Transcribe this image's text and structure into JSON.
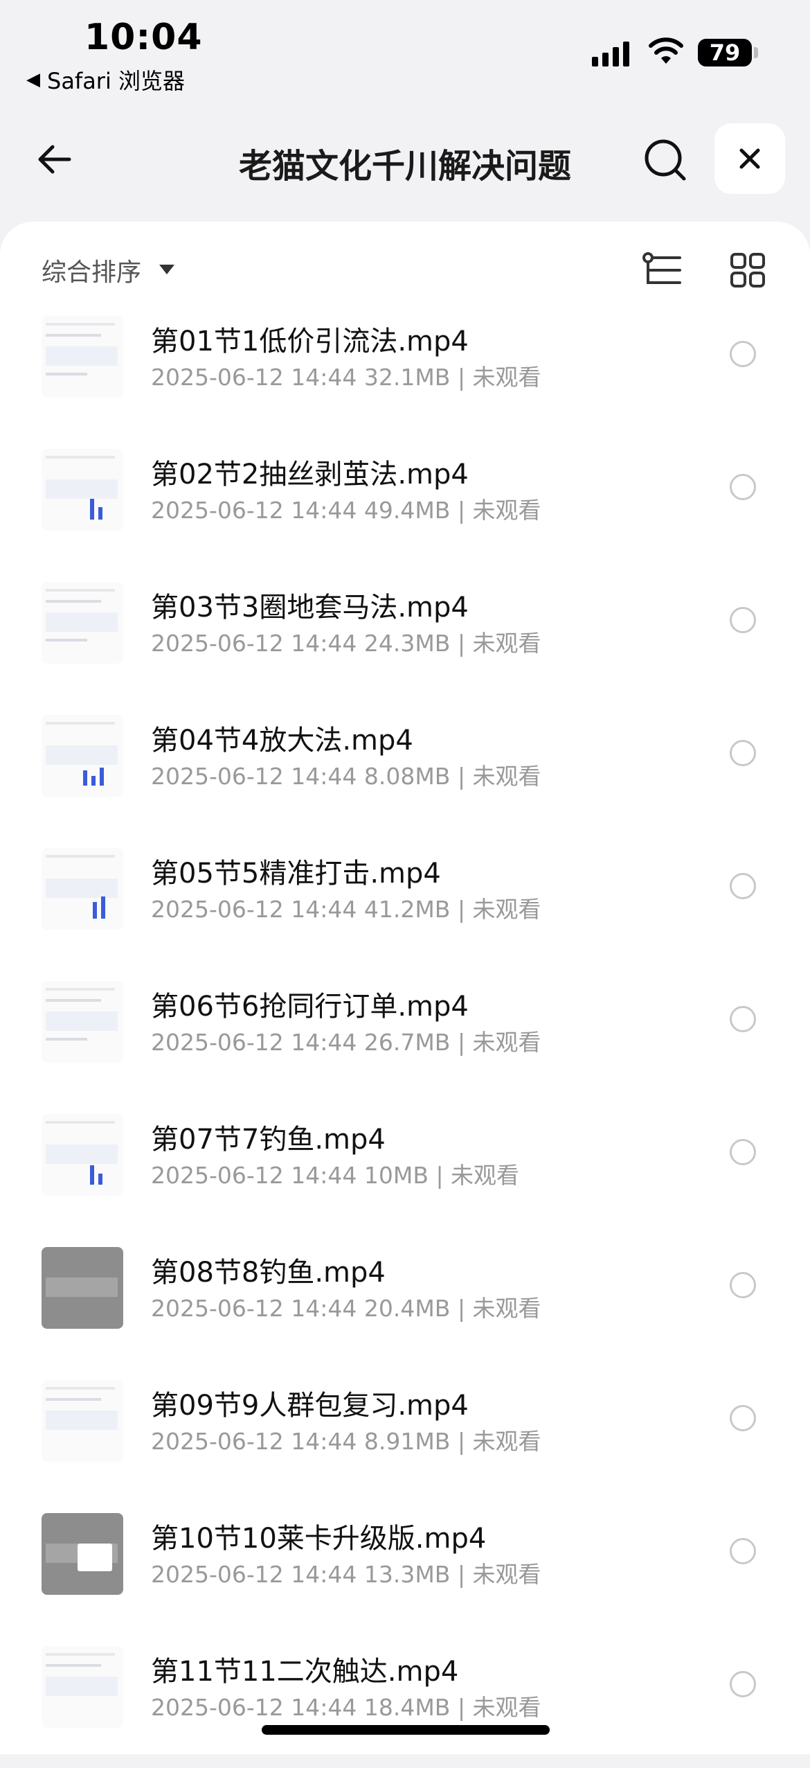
{
  "status": {
    "time": "10:04",
    "back_app": "Safari 浏览器",
    "battery": "79"
  },
  "nav": {
    "title": "老猫文化千川解决问题"
  },
  "sort": {
    "label": "综合排序"
  },
  "files": [
    {
      "name": "第01节1低价引流法.mp4",
      "meta": "2025-06-12 14:44  32.1MB | 未观看"
    },
    {
      "name": "第02节2抽丝剥茧法.mp4",
      "meta": "2025-06-12 14:44  49.4MB | 未观看"
    },
    {
      "name": "第03节3圈地套马法.mp4",
      "meta": "2025-06-12 14:44  24.3MB | 未观看"
    },
    {
      "name": "第04节4放大法.mp4",
      "meta": "2025-06-12 14:44  8.08MB | 未观看"
    },
    {
      "name": "第05节5精准打击.mp4",
      "meta": "2025-06-12 14:44  41.2MB | 未观看"
    },
    {
      "name": "第06节6抢同行订单.mp4",
      "meta": "2025-06-12 14:44  26.7MB | 未观看"
    },
    {
      "name": "第07节7钓鱼.mp4",
      "meta": "2025-06-12 14:44  10MB | 未观看"
    },
    {
      "name": "第08节8钓鱼.mp4",
      "meta": "2025-06-12 14:44  20.4MB | 未观看"
    },
    {
      "name": "第09节9人群包复习.mp4",
      "meta": "2025-06-12 14:44  8.91MB | 未观看"
    },
    {
      "name": "第10节10莱卡升级版.mp4",
      "meta": "2025-06-12 14:44  13.3MB | 未观看"
    },
    {
      "name": "第11节11二次触达.mp4",
      "meta": "2025-06-12 14:44  18.4MB | 未观看"
    }
  ],
  "icons": {
    "back": "arrow-left-icon",
    "search": "search-icon",
    "close": "close-icon",
    "sort_caret": "caret-down-icon",
    "tree": "tree-view-icon",
    "grid": "grid-view-icon",
    "select": "radio-unchecked-icon"
  },
  "colors": {
    "accent": "#3b5bdb",
    "meta_text": "#999999",
    "background": "#f2f2f4"
  }
}
